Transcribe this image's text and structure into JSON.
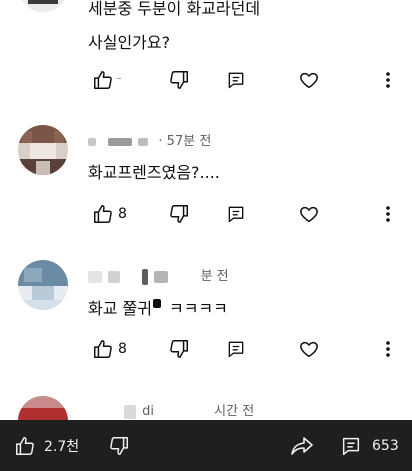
{
  "comments": [
    {
      "text_lines": [
        "세분중 두분이 화교라던데",
        "사실인가요?"
      ],
      "like_count": "",
      "avatar_colors": [
        "#3a3a3a",
        "#5a5a5a"
      ]
    },
    {
      "author_and_time": "· 57분 전",
      "text": "화교프렌즈였음?....",
      "like_count": "8",
      "avatar_colors": [
        "#7a5548",
        "#e9e2dd"
      ]
    },
    {
      "author_and_time": "분 전",
      "text": "화교 쭐귀",
      "text_tail": "ㅋㅋㅋㅋ",
      "like_count": "8",
      "avatar_colors": [
        "#6b8aa3",
        "#b9cbd8"
      ]
    },
    {
      "author_fragment": "di",
      "time": "시간 전",
      "avatar_colors": [
        "#b03030",
        "#e8c4c4"
      ]
    }
  ],
  "bottom_bar": {
    "like_count": "2.7천",
    "comment_count": "653",
    "bg_color": "#1f1f1f"
  },
  "icons": [
    "thumb-up-icon",
    "thumb-down-icon",
    "reply-icon",
    "heart-icon",
    "more-vert-icon",
    "share-icon",
    "comments-icon"
  ]
}
